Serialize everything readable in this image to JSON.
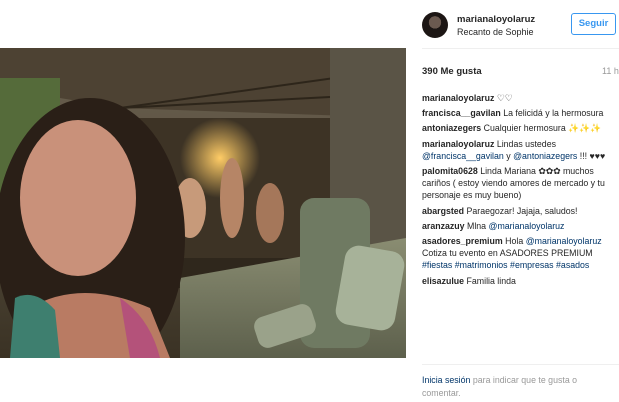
{
  "post": {
    "username": "marianaloyolaruz",
    "location": "Recanto de Sophie",
    "follow_label": "Seguir",
    "likes": "390 Me gusta",
    "time": "11 h"
  },
  "comments": [
    {
      "user": "marianaloyolaruz",
      "text": "♡♡",
      "mentions": []
    },
    {
      "user": "francisca__gavilan",
      "text": "La felicidá y la hermosura",
      "mentions": []
    },
    {
      "user": "antoniazegers",
      "text": "Cualquier hermosura ✨✨✨",
      "mentions": []
    },
    {
      "user": "marianaloyolaruz",
      "text": "Lindas ustedes",
      "mentions": [
        "@francisca__gavilan",
        "y",
        "@antoniazegers",
        "!!! ♥♥♥"
      ]
    },
    {
      "user": "palomita0628",
      "text": "Linda Mariana ✿✿✿ muchos cariños ( estoy viendo amores de mercado y tu personaje es muy bueno)",
      "mentions": []
    },
    {
      "user": "abargsted",
      "text": "Paraegozar! Jajaja, saludos!",
      "mentions": []
    },
    {
      "user": "aranzazuy",
      "text": "Mlna",
      "mentions": [
        "@marianaloyolaruz"
      ]
    },
    {
      "user": "asadores_premium",
      "text": "Hola",
      "mentions": [
        "@marianaloyolaruz",
        "Cotiza tu evento en ASADORES PREMIUM",
        "#fiestas",
        "#matrimonios",
        "#empresas",
        "#asados"
      ]
    },
    {
      "user": "elisazulue",
      "text": "Familia linda",
      "mentions": []
    }
  ],
  "footer": {
    "login_link": "Inicia sesión",
    "login_text": "para indicar que te gusta o comentar."
  },
  "colors": {
    "accent": "#3897f0",
    "link": "#003569",
    "muted": "#999999"
  }
}
